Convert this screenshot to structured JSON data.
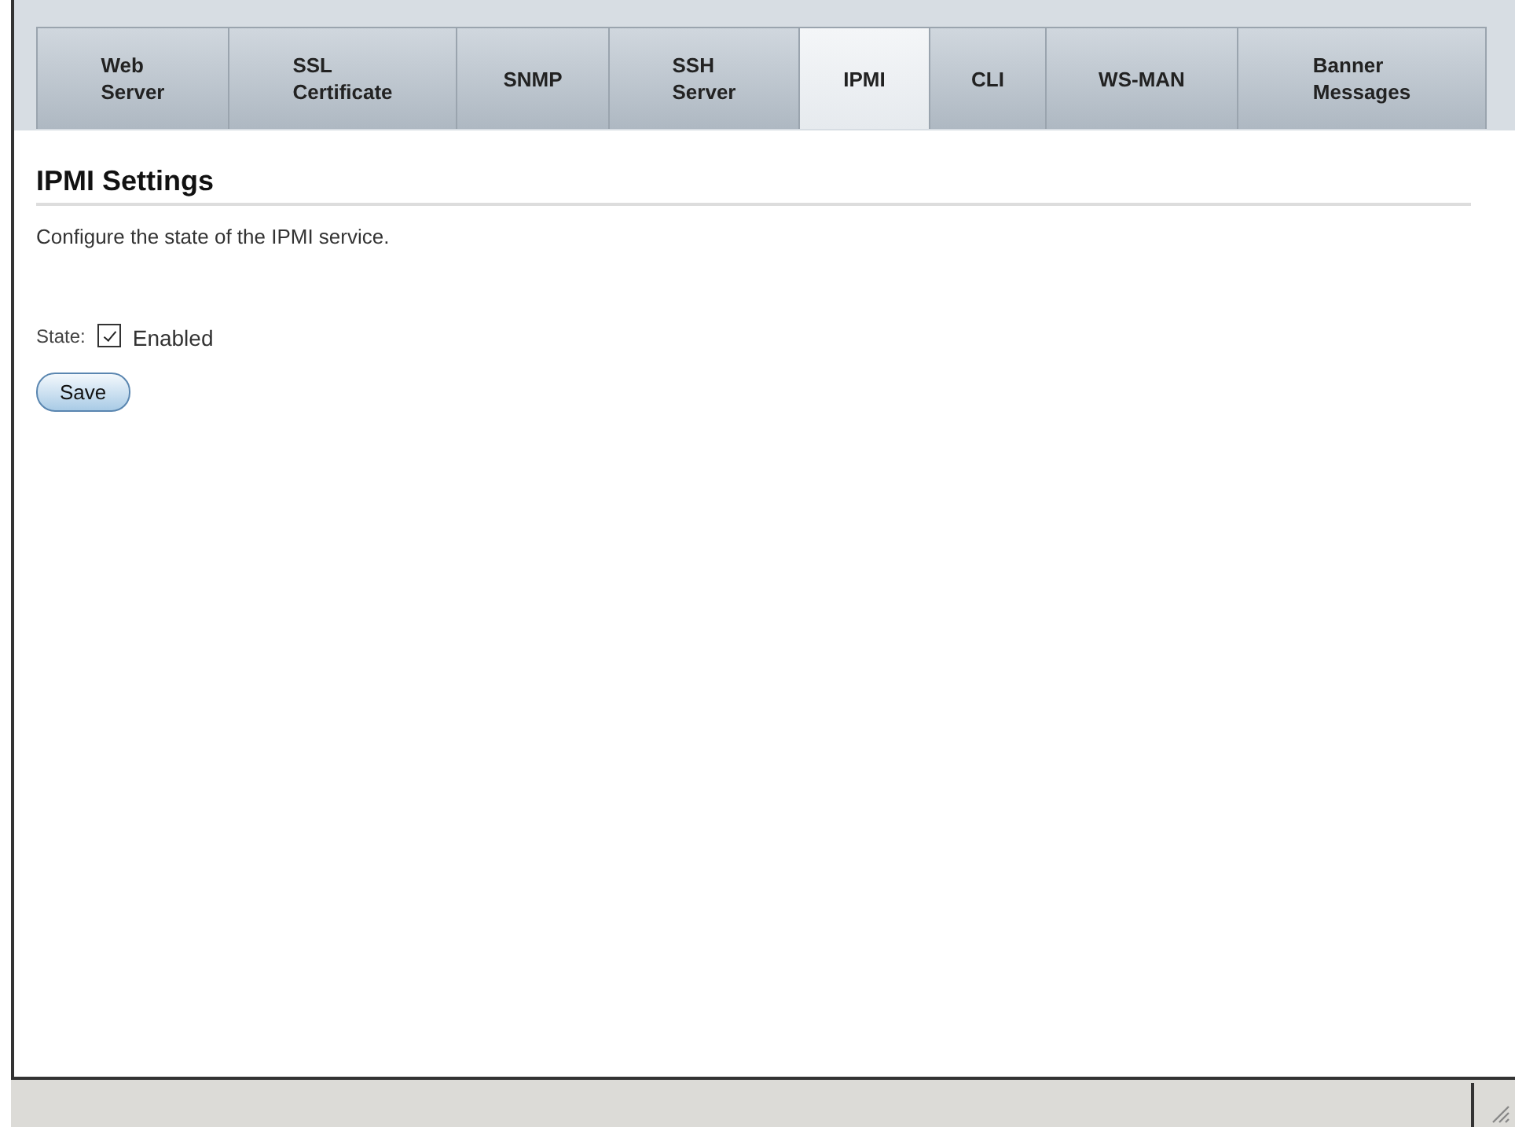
{
  "tabs": [
    {
      "label": "Web\nServer",
      "selected": false
    },
    {
      "label": "SSL\nCertificate",
      "selected": false
    },
    {
      "label": "SNMP",
      "selected": false
    },
    {
      "label": "SSH\nServer",
      "selected": false
    },
    {
      "label": "IPMI",
      "selected": true
    },
    {
      "label": "CLI",
      "selected": false
    },
    {
      "label": "WS-MAN",
      "selected": false
    },
    {
      "label": "Banner\nMessages",
      "selected": false
    }
  ],
  "section": {
    "title": "IPMI Settings",
    "description": "Configure the state of the IPMI service."
  },
  "state": {
    "label": "State:",
    "option": "Enabled",
    "checked": true
  },
  "buttons": [
    "Save"
  ]
}
